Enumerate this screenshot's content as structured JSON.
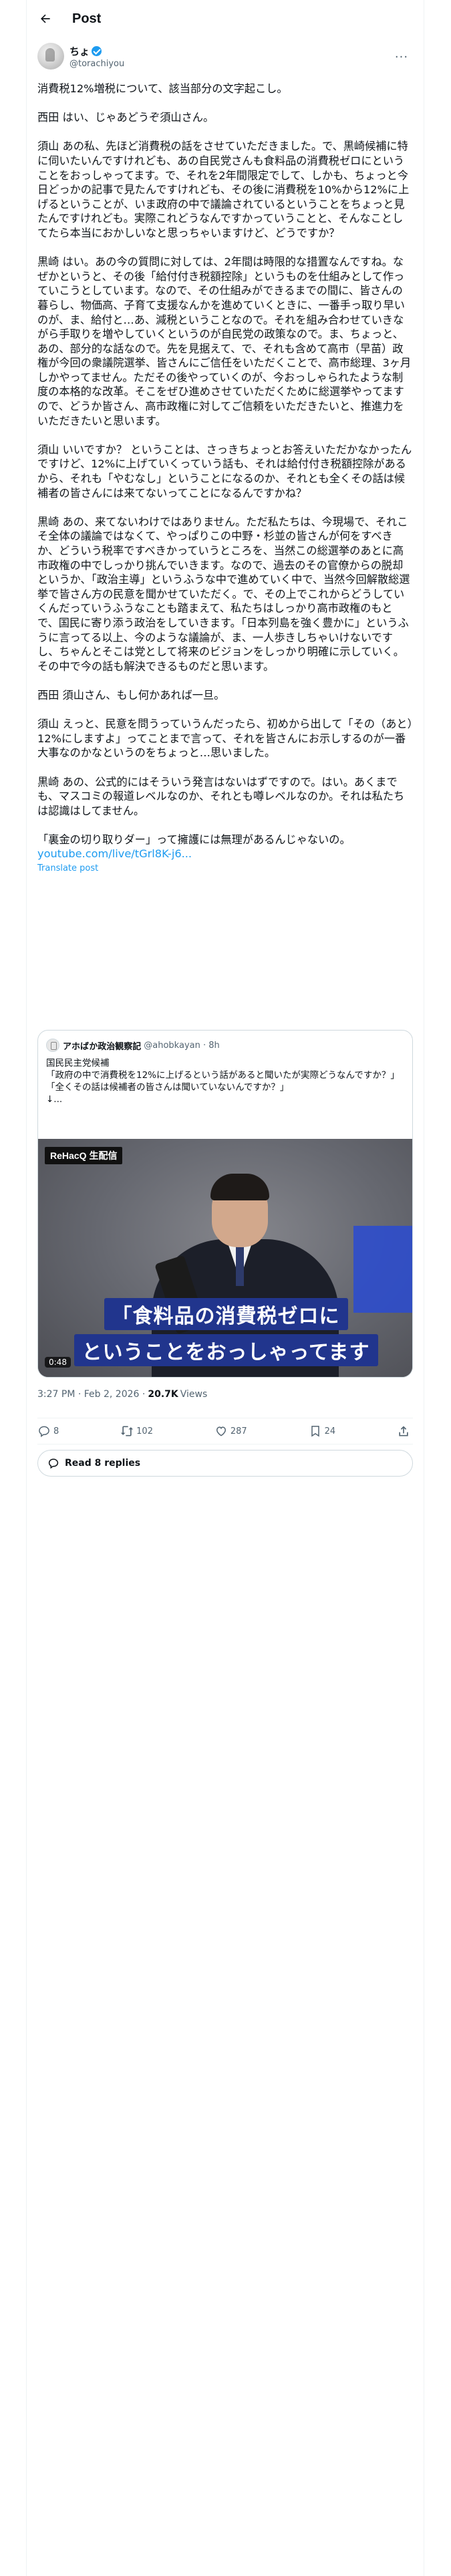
{
  "topbar": {
    "title": "Post"
  },
  "author": {
    "display_name": "ちょ",
    "handle": "@torachiyou"
  },
  "more_label": "···",
  "post": {
    "text": "消費税12%増税について、該当部分の文字起こし。\n\n西田 はい、じゃあどうぞ須山さん。\n\n須山 あの私、先ほど消費税の話をさせていただきました。で、黒崎候補に特に伺いたいんですけれども、あの自民党さんも食料品の消費税ゼロにということをおっしゃってます。で、それを2年間限定でして、しかも、ちょっと今日どっかの記事で見たんですけれども、その後に消費税を10%から12%に上げるということが、いま政府の中で議論されているということをちょっと見たんですけれども。実際これどうなんですかっていうことと、そんなことしてたら本当におかしいなと思っちゃいますけど、どうですか？\n\n黒崎 はい。あの今の質問に対しては、2年間は時限的な措置なんですね。なぜかというと、その後「給付付き税額控除」というものを仕組みとして作っていこうとしています。なので、その仕組みができるまでの間に、皆さんの暮らし、物価高、子育て支援なんかを進めていくときに、一番手っ取り早いのが、ま、給付と…あ、減税ということなので。それを組み合わせていきながら手取りを増やしていくというのが自民党の政策なので。ま、ちょっと、あの、部分的な話なので。先を見据えて、で、それも含めて高市（早苗）政権が今回の衆議院選挙、皆さんにご信任をいただくことで、高市総理、3ヶ月しかやってません。ただその後やっていくのが、今おっしゃられたような制度の本格的な改革。そこをぜひ進めさせていただくために総選挙やってますので、どうか皆さん、高市政権に対してご信頼をいただきたいと、推進力をいただきたいと思います。\n\n須山 いいですか？ ということは、さっきちょっとお答えいただかなかったんですけど、12%に上げていくっていう話も、それは給付付き税額控除があるから、それも「やむなし」ということになるのか、それとも全くその話は候補者の皆さんには来てないってことになるんですかね？\n\n黒崎 あの、来てないわけではありません。ただ私たちは、今現場で、それこそ全体の議論ではなくて、やっぱりこの中野・杉並の皆さんが何をすべきか、どういう税率ですべきかっていうところを、当然この総選挙のあとに高市政権の中でしっかり挑んでいきます。なので、過去のその官僚からの脱却というか、「政治主導」というふうな中で進めていく中で、当然今回解散総選挙で皆さん方の民意を聞かせていただく。で、その上でこれからどうしていくんだっていうふうなことも踏まえて、私たちはしっかり高市政権のもとで、国民に寄り添う政治をしていきます。「日本列島を強く豊かに」というふうに言ってる以上、今のような議論が、ま、一人歩きしちゃいけないですし、ちゃんとそこは党として将来のビジョンをしっかり明確に示していく。その中で今の話も解決できるものだと思います。\n\n西田 須山さん、もし何かあれば一旦。\n\n須山 えっと、民意を問うっていうんだったら、初めから出して「その（あと）12%にしますよ」ってことまで言って、それを皆さんにお示しするのが一番大事なのかなというのをちょっと…思いました。\n\n黒崎 あの、公式的にはそういう発言はないはずですので。はい。あくまでも、マスコミの報道レベルなのか、それとも噂レベルなのか。それは私たちは認識はしてません。\n\n「裏金の切り取りダー」って擁護には無理があるんじゃないの。",
    "link": "youtube.com/live/tGrl8K-j6...",
    "translate_label": "Translate post"
  },
  "quote": {
    "name": "アホばか政治観察記",
    "handle_time": "@ahobkayan · 8h",
    "text": "国民民主党候補\n「政府の中で消費税を12%に上げるという話があると聞いたが実際どうなんですか？」\n「全くその話は候補者の皆さんは聞いていないんですか？」\n↓...",
    "video": {
      "badge_logo": "ReHacQ",
      "badge_sub": "生配信",
      "caption_line1": "「食料品の消費税ゼロに",
      "caption_line2": "ということをおっしゃってます",
      "timecode": "0:48"
    }
  },
  "meta": {
    "time_date": "3:27 PM · Feb 2, 2026 ·",
    "views_count": "20.7K",
    "views_label": "Views"
  },
  "actions": {
    "reply_count": "8",
    "retweet_count": "102",
    "like_count": "287",
    "bookmark_count": "24"
  },
  "read_replies_label": "Read 8 replies",
  "colors": {
    "accent": "#1d9bf0",
    "text": "#0f1419",
    "muted": "#536471",
    "border": "#cfd9de",
    "caption_bg": "#21358d"
  }
}
